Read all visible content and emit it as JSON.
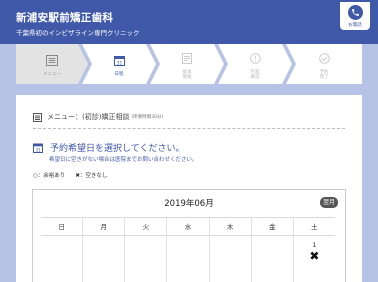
{
  "header": {
    "clinic_name": "新浦安駅前矯正歯科",
    "clinic_sub": "千葉県初のインビザライン専門クリニック",
    "phone_label": "お電話"
  },
  "steps": [
    {
      "label": "メニュー",
      "icon": "menu-list-icon",
      "state": "done"
    },
    {
      "label": "日程",
      "icon": "calendar-icon",
      "state": "active"
    },
    {
      "label": "基本\n情報",
      "icon": "info-form-icon",
      "state": "pending"
    },
    {
      "label": "内容\n確認",
      "icon": "confirm-icon",
      "state": "pending"
    },
    {
      "label": "予約\n完了",
      "icon": "check-icon",
      "state": "pending"
    }
  ],
  "menu_line": {
    "label": "メニュー：",
    "value": "(初診)矯正相談",
    "duration": "(所要時間30分)"
  },
  "section": {
    "title": "予約希望日を選択してください。",
    "note": "希望日に空きがない場合は医院までお問い合わせください。"
  },
  "legend": {
    "available": "○：余裕あり",
    "unavailable": "✖：空きなし"
  },
  "calendar": {
    "month": "2019年06月",
    "next_label": "翌月",
    "weekdays": [
      "日",
      "月",
      "火",
      "水",
      "木",
      "金",
      "土"
    ],
    "first_row": [
      {
        "day": "",
        "mark": ""
      },
      {
        "day": "",
        "mark": ""
      },
      {
        "day": "",
        "mark": ""
      },
      {
        "day": "",
        "mark": ""
      },
      {
        "day": "",
        "mark": ""
      },
      {
        "day": "",
        "mark": ""
      },
      {
        "day": "1",
        "mark": "✖"
      }
    ]
  },
  "colors": {
    "brand": "#3f58a8",
    "background": "#b7c3e6"
  }
}
